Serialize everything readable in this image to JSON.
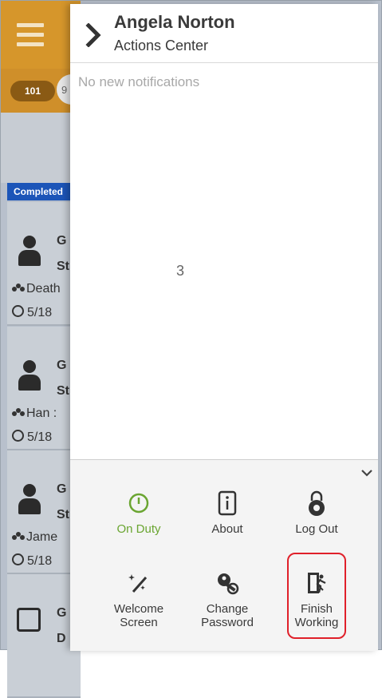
{
  "background_app": {
    "badge_left": "101",
    "badge_right": "9",
    "completed_tab": "Completed",
    "tasks": [
      {
        "line1": "G",
        "line2": "St",
        "line3": "Death",
        "line4": "5/18"
      },
      {
        "line1": "G",
        "line2": "St",
        "line3": "Han :",
        "line4": "5/18"
      },
      {
        "line1": "G",
        "line2": "St",
        "line3": "Jame",
        "line4": "5/18"
      },
      {
        "line1": "G",
        "line2": "D"
      }
    ]
  },
  "drawer": {
    "user_name": "Angela Norton",
    "subtitle": "Actions Center",
    "notifications_empty": "No new notifications",
    "stray_text": "3"
  },
  "actions": [
    {
      "label": "On Duty",
      "icon": "clock-icon",
      "active": true
    },
    {
      "label": "About",
      "icon": "info-icon"
    },
    {
      "label": "Log Out",
      "icon": "lock-icon"
    },
    {
      "label_line1": "Welcome",
      "label_line2": "Screen",
      "icon": "magic-wand-icon"
    },
    {
      "label_line1": "Change",
      "label_line2": "Password",
      "icon": "key-icon"
    },
    {
      "label_line1": "Finish",
      "label_line2": "Working",
      "icon": "exit-door-icon",
      "highlighted": true
    }
  ],
  "colors": {
    "header_orange": "#d6962b",
    "active_green": "#6aa531",
    "highlight_red": "#e0202a",
    "completed_blue": "#1c55b8"
  }
}
